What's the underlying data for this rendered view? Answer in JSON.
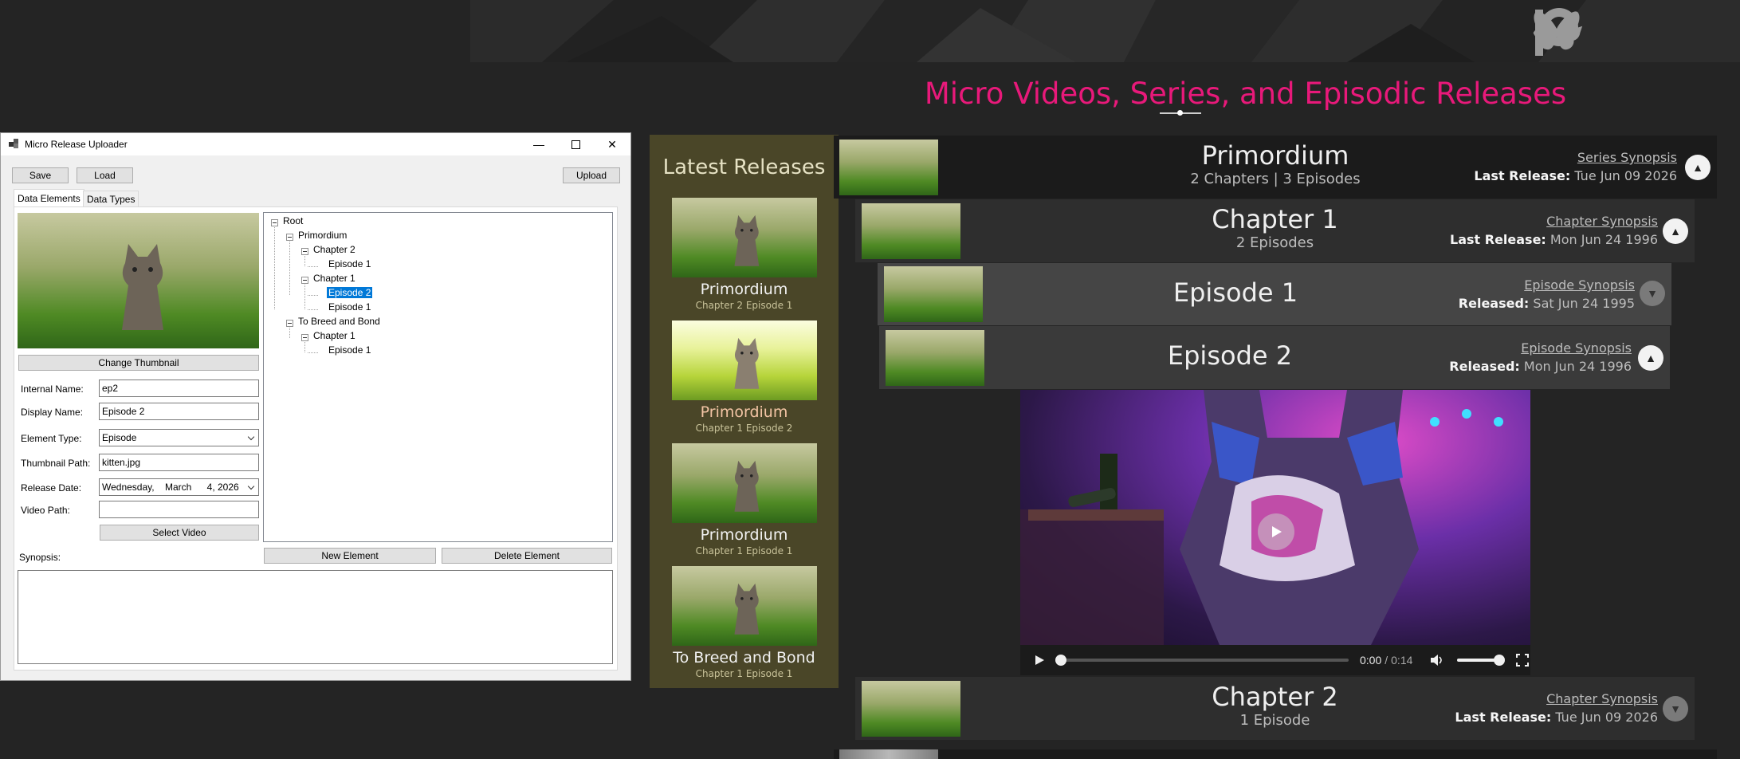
{
  "page": {
    "title": "Micro Videos, Series, and Episodic Releases",
    "header_icons": [
      "raccoon-logo-icon",
      "patreon-icon",
      "bluesky-icon"
    ],
    "accent_color": "#e8197a"
  },
  "latest": {
    "heading": "Latest Releases",
    "items": [
      {
        "title": "Primordium",
        "subtitle": "Chapter 2 Episode 1"
      },
      {
        "title": "Primordium",
        "subtitle": "Chapter 1 Episode 2"
      },
      {
        "title": "Primordium",
        "subtitle": "Chapter 1 Episode 1"
      },
      {
        "title": "To Breed and Bond",
        "subtitle": "Chapter 1 Episode 1"
      }
    ]
  },
  "tree": {
    "series": {
      "title": "Primordium",
      "sub": "2 Chapters | 3 Episodes",
      "synopsis": "Series Synopsis",
      "release_label": "Last Release:",
      "release_date": "Tue Jun 09 2026"
    },
    "chapter1": {
      "title": "Chapter 1",
      "sub": "2 Episodes",
      "synopsis": "Chapter Synopsis",
      "release_label": "Last Release:",
      "release_date": "Mon Jun 24 1996"
    },
    "episode1": {
      "title": "Episode 1",
      "synopsis": "Episode Synopsis",
      "release_label": "Released:",
      "release_date": "Sat Jun 24 1995"
    },
    "episode2": {
      "title": "Episode 2",
      "synopsis": "Episode Synopsis",
      "release_label": "Released:",
      "release_date": "Mon Jun 24 1996"
    },
    "chapter2": {
      "title": "Chapter 2",
      "sub": "1 Episode",
      "synopsis": "Chapter Synopsis",
      "release_label": "Last Release:",
      "release_date": "Tue Jun 09 2026"
    }
  },
  "video": {
    "time_current": "0:00",
    "time_sep": "/",
    "time_total": "0:14",
    "progress": 0.0,
    "volume": 0.85
  },
  "uploader": {
    "window_title": "Micro Release Uploader",
    "save": "Save",
    "load": "Load",
    "upload": "Upload",
    "tabs": [
      "Data Elements",
      "Data Types"
    ],
    "change_thumbnail": "Change Thumbnail",
    "fields": {
      "internal_name_label": "Internal Name:",
      "internal_name": "ep2",
      "display_name_label": "Display Name:",
      "display_name": "Episode 2",
      "element_type_label": "Element Type:",
      "element_type": "Episode",
      "thumbnail_path_label": "Thumbnail Path:",
      "thumbnail_path": "kitten.jpg",
      "release_date_label": "Release Date:",
      "release_date_day": "Wednesday,",
      "release_date_month": "March",
      "release_date_rest": "4, 2026",
      "video_path_label": "Video Path:",
      "video_path": ""
    },
    "select_video": "Select Video",
    "new_element": "New Element",
    "delete_element": "Delete Element",
    "synopsis_label": "Synopsis:",
    "synopsis": "",
    "treeview": [
      {
        "label": "Root"
      },
      {
        "label": "Primordium"
      },
      {
        "label": "Chapter 2"
      },
      {
        "label": "Episode 1"
      },
      {
        "label": "Chapter 1"
      },
      {
        "label": "Episode 2"
      },
      {
        "label": "Episode 1"
      },
      {
        "label": "To Breed and Bond"
      },
      {
        "label": "Chapter 1"
      },
      {
        "label": "Episode 1"
      }
    ]
  }
}
